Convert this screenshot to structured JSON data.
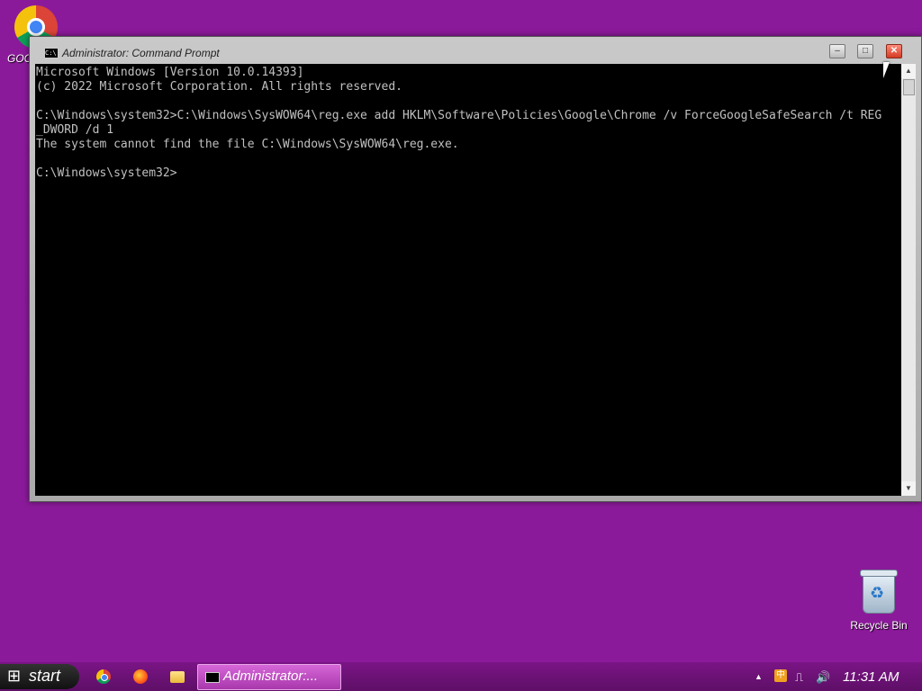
{
  "desktop": {
    "chrome_label": "GOC",
    "recycle_label": "Recycle Bin"
  },
  "window": {
    "title": "Administrator: Command Prompt",
    "minimize_glyph": "–",
    "maximize_glyph": "□",
    "close_glyph": "✕",
    "console_lines": [
      "Microsoft Windows [Version 10.0.14393]",
      "(c) 2022 Microsoft Corporation. All rights reserved.",
      "",
      "C:\\Windows\\system32>C:\\Windows\\SysWOW64\\reg.exe add HKLM\\Software\\Policies\\Google\\Chrome /v ForceGoogleSafeSearch /t REG",
      "_DWORD /d 1",
      "The system cannot find the file C:\\Windows\\SysWOW64\\reg.exe.",
      "",
      "C:\\Windows\\system32>"
    ]
  },
  "taskbar": {
    "start_label": "start",
    "task_label": "Administrator:...",
    "ime_label": "中",
    "clock": "11:31 AM"
  }
}
